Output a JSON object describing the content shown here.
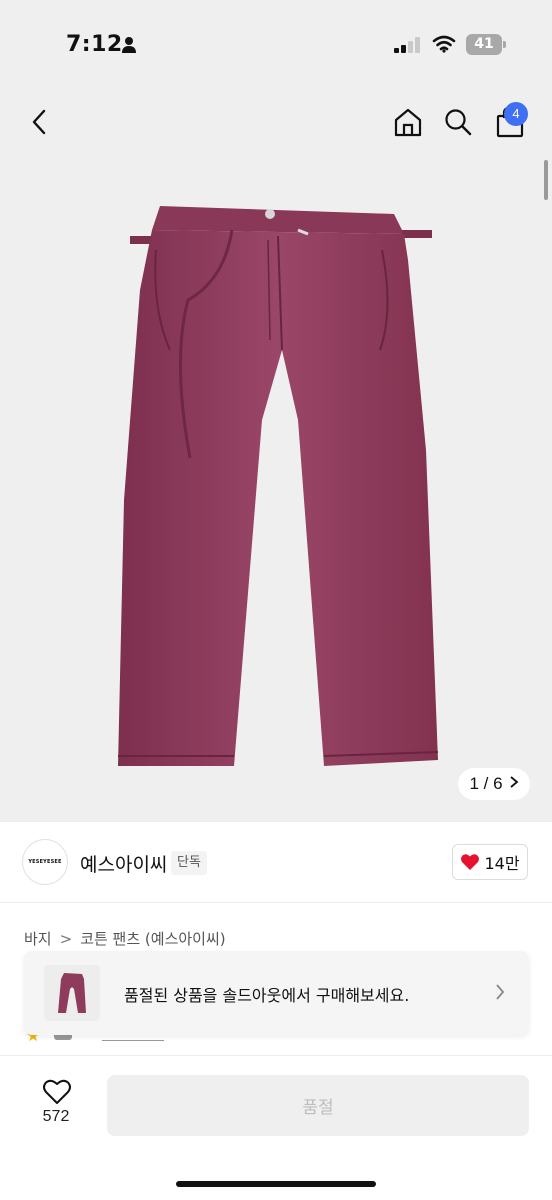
{
  "status_bar": {
    "time": "7:12",
    "battery": "41",
    "icons": [
      "person-icon",
      "signal-icon",
      "wifi-icon",
      "battery-icon"
    ]
  },
  "nav": {
    "icons": [
      "back-icon",
      "home-icon",
      "search-icon",
      "bag-icon"
    ],
    "cart_count": "4"
  },
  "hero": {
    "product_color": "#8e3b5c",
    "pager": "1 / 6",
    "pager_icon": "chevron-right-icon"
  },
  "brand": {
    "logo_text": "YESEYESEE",
    "name": "예스아이씨",
    "exclusive_badge": "단독",
    "like_count": "14만",
    "like_icon": "heart-filled-icon",
    "like_color": "#e8112d"
  },
  "breadcrumb": {
    "items": [
      "바지",
      "코튼 팬츠 (예스아이씨)"
    ],
    "separator": ">"
  },
  "banner": {
    "text": "품절된 상품을 솔드아웃에서 구매해보세요.",
    "chevron_icon": "chevron-right-icon"
  },
  "bottom_bar": {
    "wish_count": "572",
    "wish_icon": "heart-outline-icon",
    "soldout_label": "품절"
  }
}
